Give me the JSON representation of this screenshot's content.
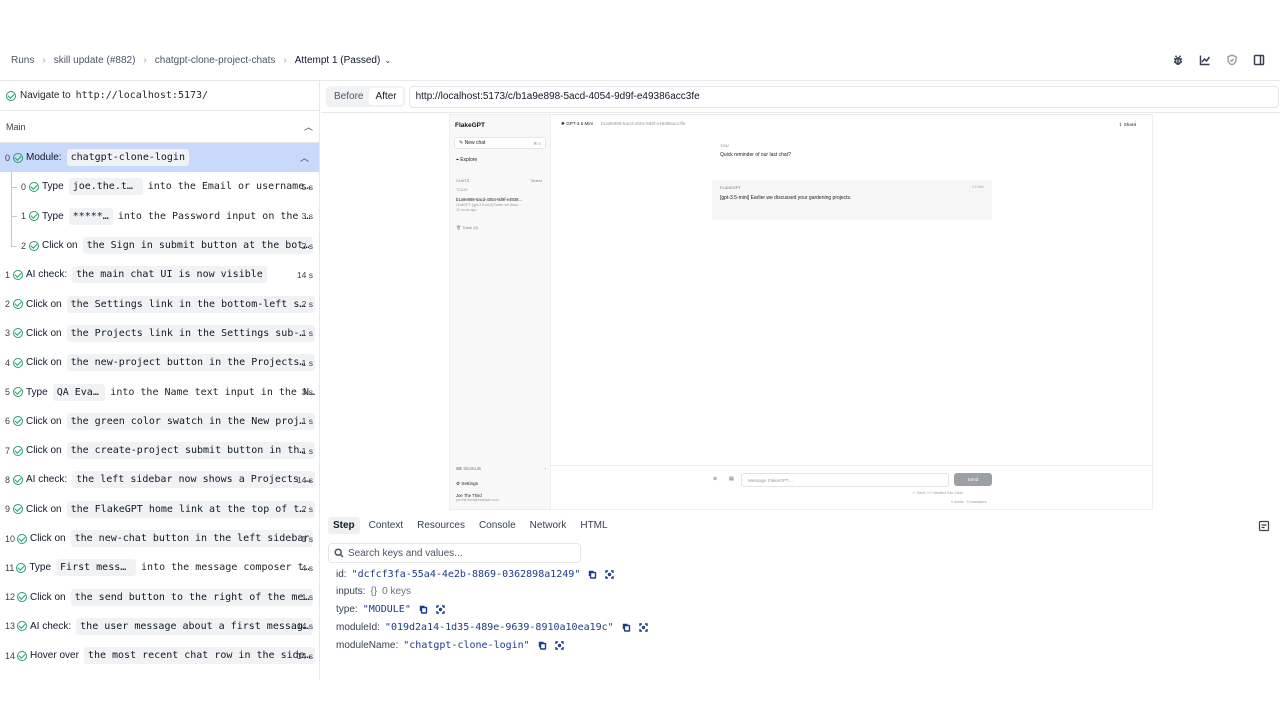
{
  "breadcrumb": {
    "items": [
      "Runs",
      "skill update (#882)",
      "chatgpt-clone-project-chats"
    ],
    "current": "Attempt 1 (Passed)"
  },
  "toolbar": {
    "icons": [
      "bug-icon",
      "chart-icon",
      "shield-icon",
      "sidebar-icon"
    ]
  },
  "navigate": {
    "label": "Navigate to",
    "url": "http://localhost:5173/"
  },
  "section": {
    "title": "Main"
  },
  "module_step": {
    "num": "0",
    "verb": "Module:",
    "name": "chatgpt-clone-login"
  },
  "sub_steps": [
    {
      "num": "0",
      "verb": "Type",
      "chip": "joe.the.thi…",
      "rest": "into the Email or username…",
      "dur": "5 s"
    },
    {
      "num": "1",
      "verb": "Type",
      "chip": "*****…",
      "rest": "into the Password input on the …",
      "dur": "3 s"
    },
    {
      "num": "2",
      "verb": "Click on",
      "chip": "the Sign in submit button at the bot…",
      "rest": "",
      "dur": "2 s"
    }
  ],
  "steps": [
    {
      "num": "1",
      "verb": "AI check:",
      "chip": "the main chat UI is now visible",
      "dur": "14 s"
    },
    {
      "num": "2",
      "verb": "Click on",
      "chip": "the Settings link in the bottom-left si…",
      "dur": "2 s"
    },
    {
      "num": "3",
      "verb": "Click on",
      "chip": "the Projects link in the Settings sub-n…",
      "dur": "1 s"
    },
    {
      "num": "4",
      "verb": "Click on",
      "chip": "the new-project button in the Projects …",
      "dur": "1 s"
    },
    {
      "num": "5",
      "verb": "Type",
      "chip": "QA Eval…",
      "rest": "into the Name text input in the N…",
      "dur": "3 s"
    },
    {
      "num": "6",
      "verb": "Click on",
      "chip": "the green color swatch in the New proje…",
      "dur": "1 s"
    },
    {
      "num": "7",
      "verb": "Click on",
      "chip": "the create-project submit button in the…",
      "dur": "1 s"
    },
    {
      "num": "8",
      "verb": "AI check:",
      "chip": "the left sidebar now shows a Projects …",
      "dur": "14 s"
    },
    {
      "num": "9",
      "verb": "Click on",
      "chip": "the FlakeGPT home link at the top of th…",
      "dur": "2 s"
    },
    {
      "num": "10",
      "verb": "Click on",
      "chip": "the new-chat button in the left sidebar",
      "dur": "1 s"
    },
    {
      "num": "11",
      "verb": "Type",
      "chip": "First messag…",
      "rest": "into the message composer t…",
      "dur": "4 s"
    },
    {
      "num": "12",
      "verb": "Click on",
      "chip": "the send button to the right of the me…",
      "dur": "1 s"
    },
    {
      "num": "13",
      "verb": "AI check:",
      "chip": "the user message about a first messag…",
      "dur": "14 s"
    },
    {
      "num": "14",
      "verb": "Hover over",
      "chip": "the most recent chat row in the side…",
      "dur": "14 s"
    }
  ],
  "viewer": {
    "before": "Before",
    "after": "After",
    "url": "http://localhost:5173/c/b1a9e898-5acd-4054-9d9f-e49386acc3fe"
  },
  "preview": {
    "brand": "FlakeGPT",
    "new_chat": "New chat",
    "new_chat_kbd": "⌘ K",
    "explore": "Explore",
    "chats": "CHATS",
    "select": "Select",
    "today": "TODAY",
    "chat_title": "b1a9e898-5acd-4054-9d9f-e4938…",
    "chat_snippet": "ChatGPT: [gpt-3.5-mini] Earlier we discu…",
    "chat_time": "10 hours ago",
    "trash": "Trash (0)",
    "shortcuts": "Shortcuts",
    "settings": "Settings",
    "user_name": "Joe The Third",
    "user_email": "joe.the.third@example.com",
    "model": "GPT-3.5 Mini",
    "conv_id": "b1a9e898-5acd-4054-9d9f-e49386acc3fe",
    "share": "Share",
    "you": "YOU",
    "user_msg": "Quick reminder of our last chat?",
    "bot_name": "FLAKEGPT",
    "bot_time": "3.5 Mini",
    "bot_msg": "[gpt-3.5-mini] Earlier we discussed your gardening projects.",
    "composer_placeholder": "Message FlakeGPT…",
    "send": "Send",
    "hints": "↵ Send   ⇧↵ Newline   Esc Clear",
    "count": "0 words · 0 characters"
  },
  "detail_tabs": [
    "Step",
    "Context",
    "Resources",
    "Console",
    "Network",
    "HTML"
  ],
  "search": {
    "placeholder": "Search keys and values..."
  },
  "details": {
    "id_key": "id:",
    "id_val": "\"dcfcf3fa-55a4-4e2b-8869-0362898a1249\"",
    "inputs_key": "inputs:",
    "inputs_val": "{}",
    "inputs_count": "0 keys",
    "type_key": "type:",
    "type_val": "\"MODULE\"",
    "moduleId_key": "moduleId:",
    "moduleId_val": "\"019d2a14-1d35-489e-9639-8910a10ea19c\"",
    "moduleName_key": "moduleName:",
    "moduleName_val": "\"chatgpt-clone-login\""
  }
}
